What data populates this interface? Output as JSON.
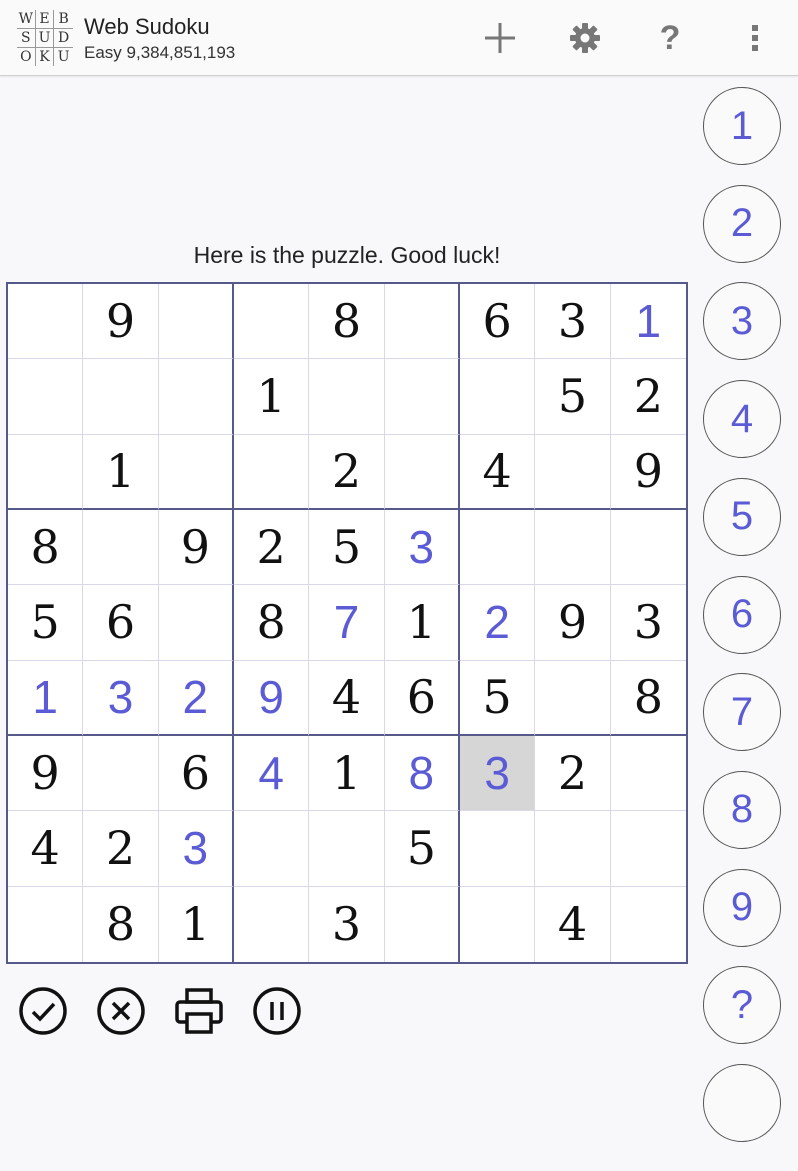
{
  "app": {
    "logo_letters": [
      "W",
      "E",
      "B",
      "S",
      "U",
      "D",
      "O",
      "K",
      "U"
    ],
    "title": "Web Sudoku",
    "subtitle": "Easy 9,384,851,193"
  },
  "toolbar": {
    "new_icon": "plus-icon",
    "settings_icon": "gear-icon",
    "help_icon": "question-icon",
    "menu_icon": "more-vertical-icon"
  },
  "message": "Here is the puzzle. Good luck!",
  "board": {
    "selected": [
      6,
      6
    ],
    "rows": [
      [
        "",
        "9",
        "",
        "",
        "8",
        "",
        "6",
        "3",
        "1"
      ],
      [
        "",
        "",
        "",
        "1",
        "",
        "",
        "",
        "5",
        "2"
      ],
      [
        "",
        "1",
        "",
        "",
        "2",
        "",
        "4",
        "",
        "9"
      ],
      [
        "8",
        "",
        "9",
        "2",
        "5",
        "3",
        "",
        "",
        ""
      ],
      [
        "5",
        "6",
        "",
        "8",
        "7",
        "1",
        "2",
        "9",
        "3"
      ],
      [
        "1",
        "3",
        "2",
        "9",
        "4",
        "6",
        "5",
        "",
        "8"
      ],
      [
        "9",
        "",
        "6",
        "4",
        "1",
        "8",
        "3",
        "2",
        ""
      ],
      [
        "4",
        "2",
        "3",
        "",
        "",
        "5",
        "",
        "",
        ""
      ],
      [
        "",
        "8",
        "1",
        "",
        "3",
        "",
        "",
        "4",
        ""
      ]
    ],
    "user_entered": [
      [
        0,
        8
      ],
      [
        3,
        5
      ],
      [
        4,
        4
      ],
      [
        4,
        6
      ],
      [
        5,
        0
      ],
      [
        5,
        1
      ],
      [
        5,
        2
      ],
      [
        5,
        3
      ],
      [
        6,
        3
      ],
      [
        6,
        5
      ],
      [
        6,
        6
      ],
      [
        7,
        2
      ]
    ]
  },
  "actions": {
    "check_icon": "check-circle-icon",
    "clear_icon": "close-circle-icon",
    "print_icon": "printer-icon",
    "pause_icon": "pause-circle-icon"
  },
  "number_pad": [
    "1",
    "2",
    "3",
    "4",
    "5",
    "6",
    "7",
    "8",
    "9",
    "?",
    ""
  ],
  "colors": {
    "user_digit": "#5b5bd6",
    "grid_border": "#555a8a",
    "selected_cell": "#d6d6d6"
  }
}
